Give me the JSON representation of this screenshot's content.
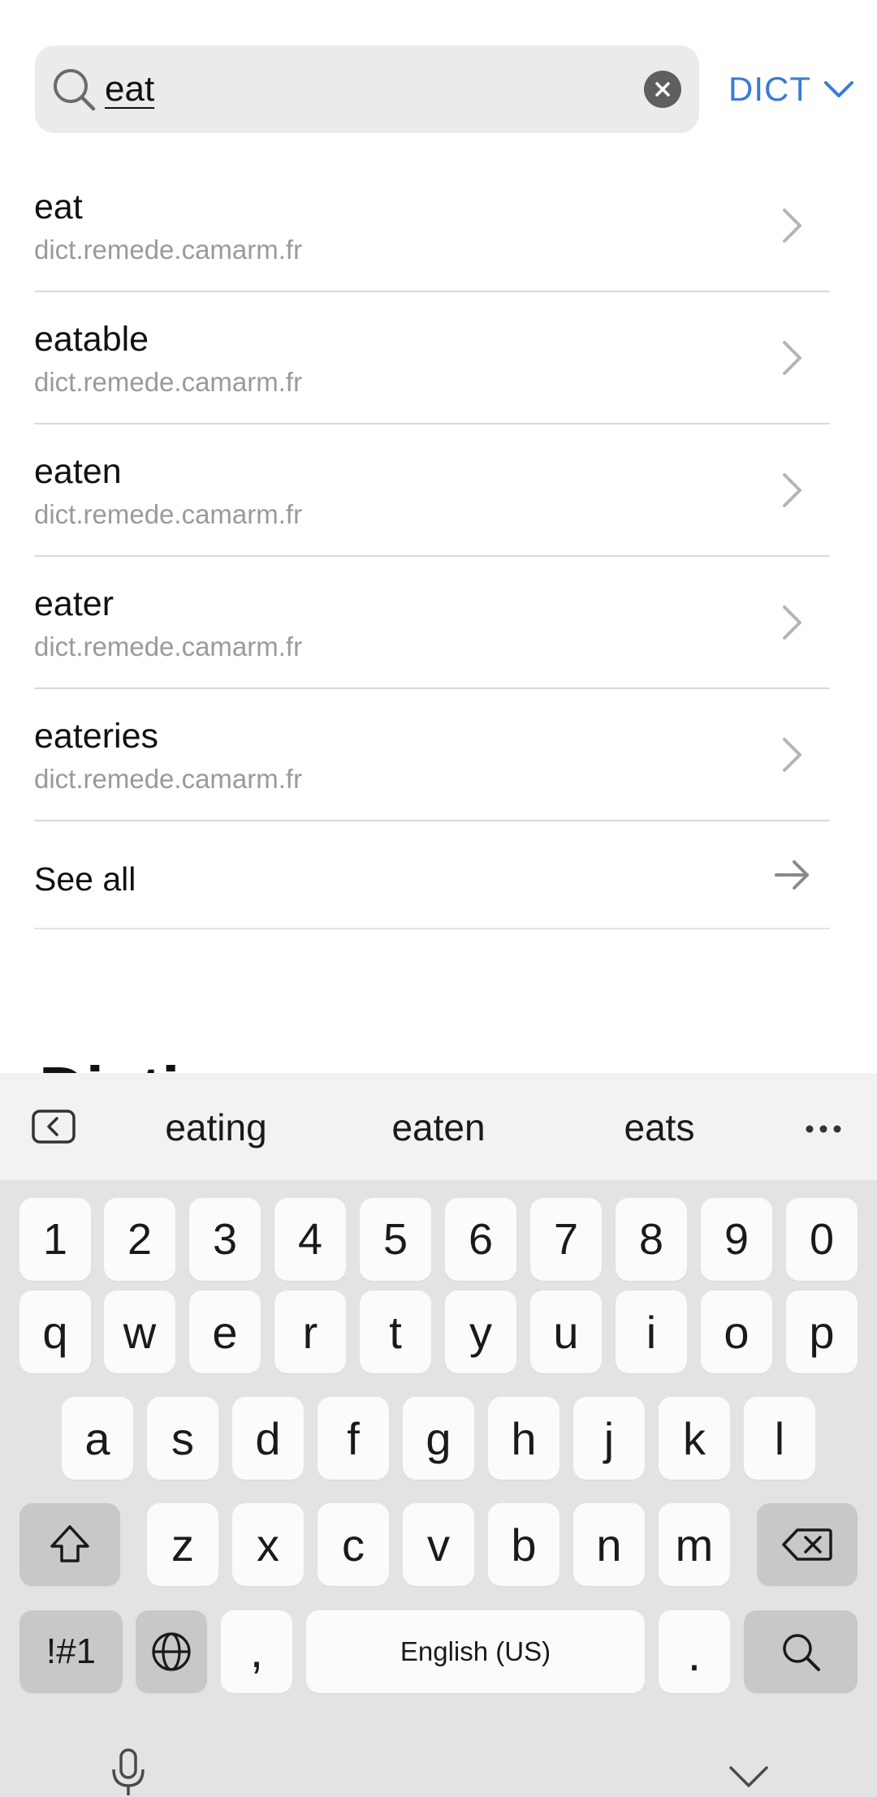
{
  "search": {
    "query": "eat",
    "dict_label": "DICT"
  },
  "results": [
    {
      "word": "eat",
      "source": "dict.remede.camarm.fr"
    },
    {
      "word": "eatable",
      "source": "dict.remede.camarm.fr"
    },
    {
      "word": "eaten",
      "source": "dict.remede.camarm.fr"
    },
    {
      "word": "eater",
      "source": "dict.remede.camarm.fr"
    },
    {
      "word": "eateries",
      "source": "dict.remede.camarm.fr"
    }
  ],
  "see_all_label": "See all",
  "section_heading": "Dicti",
  "keyboard": {
    "suggestions": [
      "eating",
      "eaten",
      "eats"
    ],
    "row_numbers": [
      "1",
      "2",
      "3",
      "4",
      "5",
      "6",
      "7",
      "8",
      "9",
      "0"
    ],
    "row_top": [
      "q",
      "w",
      "e",
      "r",
      "t",
      "y",
      "u",
      "i",
      "o",
      "p"
    ],
    "row_middle": [
      "a",
      "s",
      "d",
      "f",
      "g",
      "h",
      "j",
      "k",
      "l"
    ],
    "row_bottom": [
      "z",
      "x",
      "c",
      "v",
      "b",
      "n",
      "m"
    ],
    "symbols_label": "!#1",
    "comma_label": ",",
    "space_label": "English (US)",
    "period_label": "."
  },
  "colors": {
    "accent": "#3a7bd5",
    "search_bg": "#ebebeb",
    "keyboard_bg": "#e3e3e3"
  }
}
